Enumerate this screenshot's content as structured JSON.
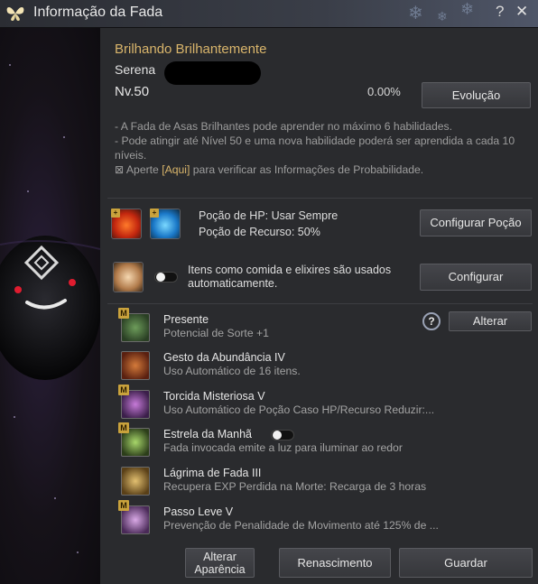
{
  "window": {
    "title": "Informação da Fada",
    "help_label": "?",
    "close_label": "✕"
  },
  "fairy": {
    "name": "Brilhando Brilhantemente",
    "owner": "Serena",
    "level": "Nv.50",
    "exp_percent": "0.00%",
    "evolution_button": "Evolução"
  },
  "notes": {
    "line1": "- A Fada de Asas Brilhantes pode aprender no máximo 6 habilidades.",
    "line2": "- Pode atingir até Nível 50 e uma nova habilidade poderá ser aprendida a cada 10 níveis.",
    "line3_prefix": "⊠ Aperte ",
    "line3_link": "[Aqui]",
    "line3_suffix": " para verificar as Informações de Probabilidade."
  },
  "potion": {
    "hp_label": "Poção de HP: Usar Sempre",
    "resource_label": "Poção de Recurso: 50%",
    "config_button": "Configurar Poção"
  },
  "auto_use": {
    "label_line1": "Itens como comida e elixires são usados",
    "label_line2": "automaticamente.",
    "config_button": "Configurar"
  },
  "skills": {
    "change_button": "Alterar",
    "help_icon": "?",
    "items": [
      {
        "name": "Presente",
        "desc": "Potencial de Sorte +1",
        "badge": "M",
        "icon": "clover-icon"
      },
      {
        "name": "Gesto da Abundância IV",
        "desc": "Uso Automático de 16 itens.",
        "badge": "",
        "icon": "fairy-icon"
      },
      {
        "name": "Torcida Misteriosa V",
        "desc": "Uso Automático de Poção Caso HP/Recurso Reduzir:...",
        "badge": "M",
        "icon": "potions-icon"
      },
      {
        "name": "Estrela da Manhã",
        "desc": "Fada invocada emite a luz para iluminar ao redor",
        "badge": "M",
        "icon": "lantern-icon"
      },
      {
        "name": "Lágrima de Fada III",
        "desc": "Recupera EXP Perdida na Morte: Recarga de 3 horas",
        "badge": "",
        "icon": "tear-icon"
      },
      {
        "name": "Passo Leve V",
        "desc": "Prevenção de Penalidade de Movimento até 125% de ...",
        "badge": "M",
        "icon": "boot-icon"
      }
    ]
  },
  "footer": {
    "appearance_line1": "Alterar",
    "appearance_line2": "Aparência",
    "rebirth_button": "Renascimento",
    "save_button": "Guardar"
  },
  "colors": {
    "accent_gold": "#d9b56b",
    "panel_bg": "#2a2b2e",
    "title_bg": "#3a3e48"
  }
}
